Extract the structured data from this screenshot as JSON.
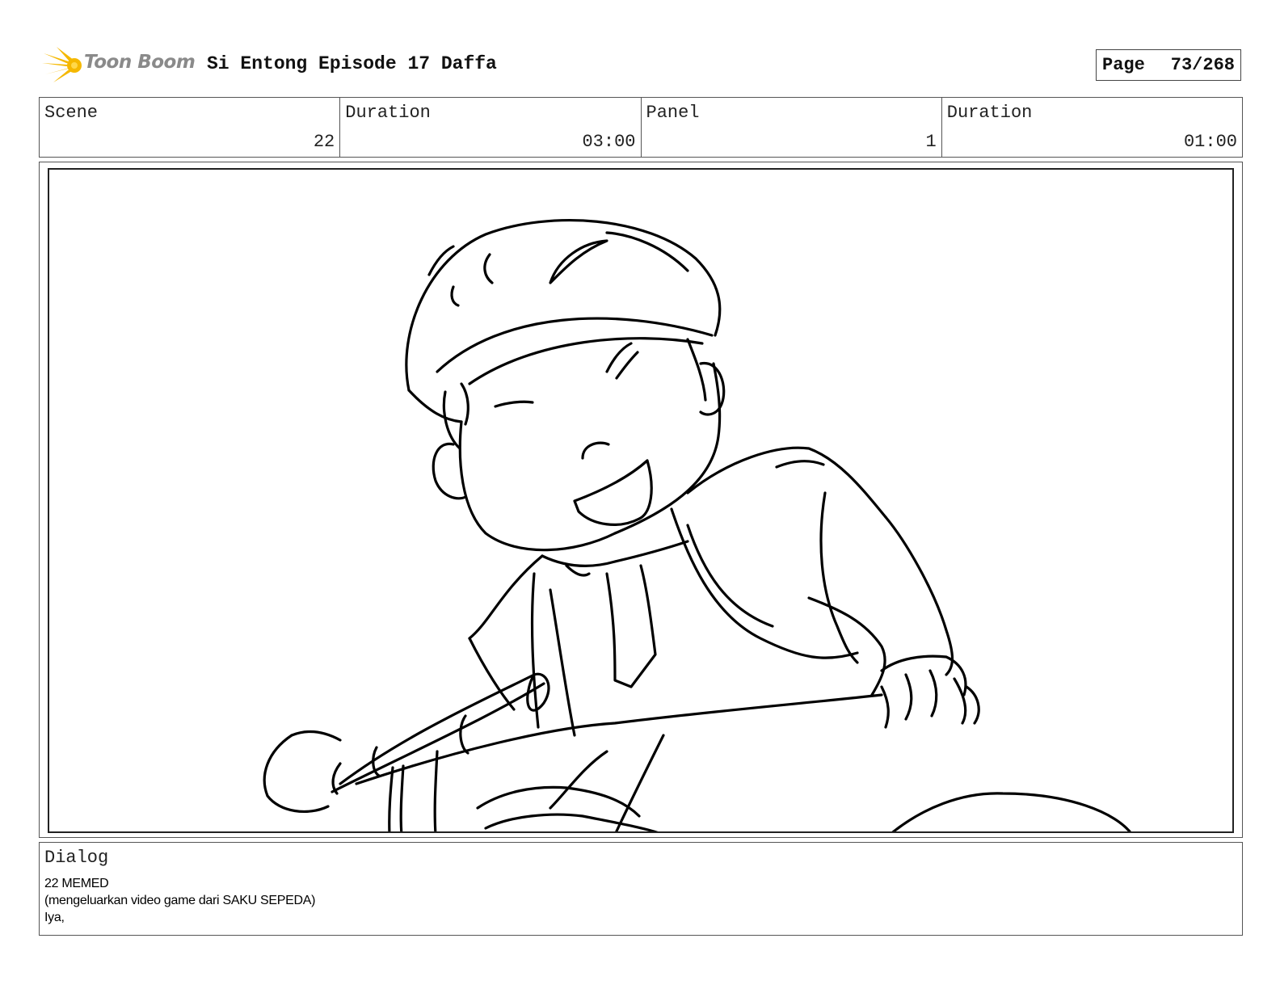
{
  "header": {
    "logo_text": "Toon Boom",
    "title": "Si Entong Episode 17 Daffa",
    "page_label": "Page",
    "page_value": "73/268"
  },
  "info": {
    "scene_label": "Scene",
    "scene_value": "22",
    "scene_duration_label": "Duration",
    "scene_duration_value": "03:00",
    "panel_label": "Panel",
    "panel_value": "1",
    "panel_duration_label": "Duration",
    "panel_duration_value": "01:00"
  },
  "dialog": {
    "label": "Dialog",
    "lines": [
      "22 MEMED",
      "(mengeluarkan video game dari SAKU SEPEDA)",
      "Iya,"
    ]
  },
  "colors": {
    "logo_accent": "#f5b800",
    "logo_text": "#8a8a8a",
    "border": "#555555"
  }
}
